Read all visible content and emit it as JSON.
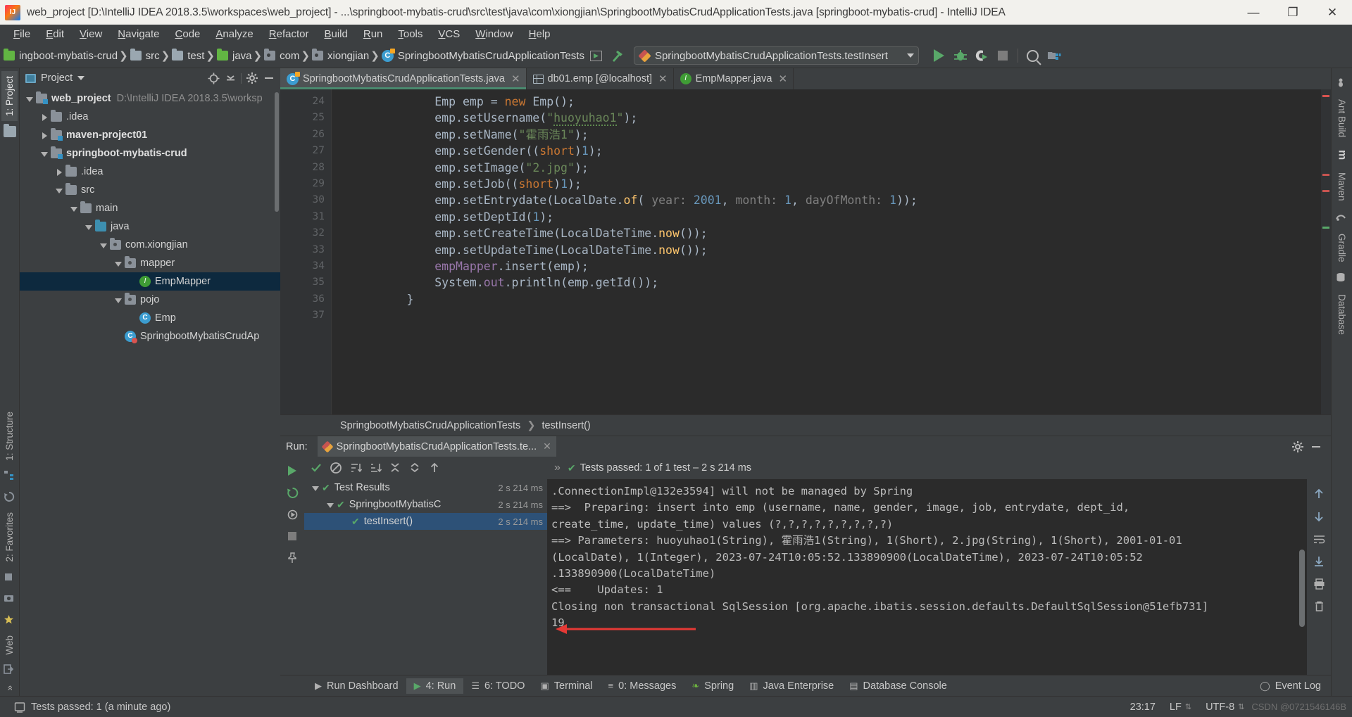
{
  "window": {
    "title": "web_project [D:\\IntelliJ IDEA 2018.3.5\\workspaces\\web_project] - ...\\springboot-mybatis-crud\\src\\test\\java\\com\\xiongjian\\SpringbootMybatisCrudApplicationTests.java [springboot-mybatis-crud] - IntelliJ IDEA",
    "minimize": "—",
    "maximize": "❐",
    "close": "✕"
  },
  "menu": [
    {
      "label": "File"
    },
    {
      "label": "Edit"
    },
    {
      "label": "View"
    },
    {
      "label": "Navigate"
    },
    {
      "label": "Code"
    },
    {
      "label": "Analyze"
    },
    {
      "label": "Refactor"
    },
    {
      "label": "Build"
    },
    {
      "label": "Run"
    },
    {
      "label": "Tools"
    },
    {
      "label": "VCS"
    },
    {
      "label": "Window"
    },
    {
      "label": "Help"
    }
  ],
  "navbar": {
    "crumbs": [
      {
        "label": "ingboot-mybatis-crud",
        "icon": "module-icon"
      },
      {
        "label": "src",
        "icon": "folder-icon"
      },
      {
        "label": "test",
        "icon": "folder-icon"
      },
      {
        "label": "java",
        "icon": "source-folder-icon"
      },
      {
        "label": "com",
        "icon": "package-icon"
      },
      {
        "label": "xiongjian",
        "icon": "package-icon"
      },
      {
        "label": "SpringbootMybatisCrudApplicationTests",
        "icon": "class-icon"
      }
    ],
    "run_config": "SpringbootMybatisCrudApplicationTests.testInsert",
    "icons": [
      "run-icon",
      "debug-icon",
      "run-with-coverage-icon",
      "stop-icon",
      "search-everywhere-icon",
      "project-structure-icon"
    ]
  },
  "sidebar_left": {
    "tabs": [
      {
        "label": "1: Project",
        "active": true
      }
    ],
    "icons": [
      "structure-icon",
      "favorites-icon",
      "web-icon"
    ]
  },
  "sidebar_right": {
    "tabs": [
      {
        "label": "Ant Build"
      },
      {
        "label": "m"
      },
      {
        "label": "Maven"
      },
      {
        "label": "Gradle"
      },
      {
        "label": "Database"
      }
    ]
  },
  "project_panel": {
    "title": "Project",
    "buttons": [
      "locate-icon",
      "collapse-all-icon",
      "settings-gear-icon",
      "hide-icon"
    ],
    "tree": [
      {
        "depth": 0,
        "label": "web_project",
        "sub": "D:\\IntelliJ IDEA 2018.3.5\\worksp",
        "twisty": "open",
        "icon": "module-icon",
        "bold": true,
        "selected": false
      },
      {
        "depth": 1,
        "label": ".idea",
        "sub": "",
        "twisty": "closed",
        "icon": "dir-icon",
        "bold": false,
        "selected": false
      },
      {
        "depth": 1,
        "label": "maven-project01",
        "sub": "",
        "twisty": "closed",
        "icon": "module-icon",
        "bold": true,
        "selected": false
      },
      {
        "depth": 1,
        "label": "springboot-mybatis-crud",
        "sub": "",
        "twisty": "open",
        "icon": "module-icon",
        "bold": true,
        "selected": false
      },
      {
        "depth": 2,
        "label": ".idea",
        "sub": "",
        "twisty": "closed",
        "icon": "dir-icon",
        "bold": false,
        "selected": false
      },
      {
        "depth": 2,
        "label": "src",
        "sub": "",
        "twisty": "open",
        "icon": "dir-icon",
        "bold": false,
        "selected": false
      },
      {
        "depth": 3,
        "label": "main",
        "sub": "",
        "twisty": "open",
        "icon": "dir-icon",
        "bold": false,
        "selected": false
      },
      {
        "depth": 4,
        "label": "java",
        "sub": "",
        "twisty": "open",
        "icon": "source-folder-icon",
        "bold": false,
        "selected": false
      },
      {
        "depth": 5,
        "label": "com.xiongjian",
        "sub": "",
        "twisty": "open",
        "icon": "package-icon",
        "bold": false,
        "selected": false
      },
      {
        "depth": 6,
        "label": "mapper",
        "sub": "",
        "twisty": "open",
        "icon": "package-icon",
        "bold": false,
        "selected": false
      },
      {
        "depth": 7,
        "label": "EmpMapper",
        "sub": "",
        "twisty": "none",
        "icon": "interface-icon",
        "bold": false,
        "selected": true
      },
      {
        "depth": 6,
        "label": "pojo",
        "sub": "",
        "twisty": "open",
        "icon": "package-icon",
        "bold": false,
        "selected": false
      },
      {
        "depth": 7,
        "label": "Emp",
        "sub": "",
        "twisty": "none",
        "icon": "class-icon",
        "bold": false,
        "selected": false
      },
      {
        "depth": 6,
        "label": "SpringbootMybatisCrudAp",
        "sub": "",
        "twisty": "none",
        "icon": "spring-class-icon",
        "bold": false,
        "selected": false
      }
    ]
  },
  "editor": {
    "tabs": [
      {
        "label": "SpringbootMybatisCrudApplicationTests.java",
        "icon": "java-class-icon",
        "active": true,
        "close": "✕"
      },
      {
        "label": "db01.emp [@localhost]",
        "icon": "database-table-icon",
        "active": false,
        "close": "✕"
      },
      {
        "label": "EmpMapper.java",
        "icon": "java-interface-icon",
        "active": false,
        "close": "✕"
      }
    ],
    "first_line_number": 24,
    "lines": [
      {
        "n": 24,
        "tokens": [
          {
            "t": "            ",
            "c": "punct"
          },
          {
            "t": "Emp",
            "c": "ident"
          },
          {
            "t": " emp ",
            "c": "ident"
          },
          {
            "t": "= ",
            "c": "punct"
          },
          {
            "t": "new ",
            "c": "kw"
          },
          {
            "t": "Emp",
            "c": "ident"
          },
          {
            "t": "();",
            "c": "punct"
          }
        ]
      },
      {
        "n": 25,
        "tokens": [
          {
            "t": "            ",
            "c": "punct"
          },
          {
            "t": "emp",
            "c": "ident"
          },
          {
            "t": ".",
            "c": "punct"
          },
          {
            "t": "setUsername",
            "c": "ident"
          },
          {
            "t": "(",
            "c": "punct"
          },
          {
            "t": "\"",
            "c": "str"
          },
          {
            "t": "huoyuhao1",
            "c": "str typo"
          },
          {
            "t": "\"",
            "c": "str"
          },
          {
            "t": ");",
            "c": "punct"
          }
        ]
      },
      {
        "n": 26,
        "tokens": [
          {
            "t": "            ",
            "c": "punct"
          },
          {
            "t": "emp",
            "c": "ident"
          },
          {
            "t": ".",
            "c": "punct"
          },
          {
            "t": "setName",
            "c": "ident"
          },
          {
            "t": "(",
            "c": "punct"
          },
          {
            "t": "\"霍雨浩1\"",
            "c": "str"
          },
          {
            "t": ");",
            "c": "punct"
          }
        ]
      },
      {
        "n": 27,
        "tokens": [
          {
            "t": "            ",
            "c": "punct"
          },
          {
            "t": "emp",
            "c": "ident"
          },
          {
            "t": ".",
            "c": "punct"
          },
          {
            "t": "setGender",
            "c": "ident"
          },
          {
            "t": "((",
            "c": "punct"
          },
          {
            "t": "short",
            "c": "kw"
          },
          {
            "t": ")",
            "c": "punct"
          },
          {
            "t": "1",
            "c": "num"
          },
          {
            "t": ");",
            "c": "punct"
          }
        ]
      },
      {
        "n": 28,
        "tokens": [
          {
            "t": "            ",
            "c": "punct"
          },
          {
            "t": "emp",
            "c": "ident"
          },
          {
            "t": ".",
            "c": "punct"
          },
          {
            "t": "setImage",
            "c": "ident"
          },
          {
            "t": "(",
            "c": "punct"
          },
          {
            "t": "\"2.jpg\"",
            "c": "str"
          },
          {
            "t": ");",
            "c": "punct"
          }
        ]
      },
      {
        "n": 29,
        "tokens": [
          {
            "t": "            ",
            "c": "punct"
          },
          {
            "t": "emp",
            "c": "ident"
          },
          {
            "t": ".",
            "c": "punct"
          },
          {
            "t": "setJob",
            "c": "ident"
          },
          {
            "t": "((",
            "c": "punct"
          },
          {
            "t": "short",
            "c": "kw"
          },
          {
            "t": ")",
            "c": "punct"
          },
          {
            "t": "1",
            "c": "num"
          },
          {
            "t": ");",
            "c": "punct"
          }
        ]
      },
      {
        "n": 30,
        "tokens": [
          {
            "t": "            ",
            "c": "punct"
          },
          {
            "t": "emp",
            "c": "ident"
          },
          {
            "t": ".",
            "c": "punct"
          },
          {
            "t": "setEntrydate",
            "c": "ident"
          },
          {
            "t": "(",
            "c": "punct"
          },
          {
            "t": "LocalDate",
            "c": "ident"
          },
          {
            "t": ".",
            "c": "punct"
          },
          {
            "t": "of",
            "c": "mth"
          },
          {
            "t": "( ",
            "c": "punct"
          },
          {
            "t": "year:",
            "c": "hint"
          },
          {
            "t": " ",
            "c": "punct"
          },
          {
            "t": "2001",
            "c": "num"
          },
          {
            "t": ", ",
            "c": "punct"
          },
          {
            "t": "month:",
            "c": "hint"
          },
          {
            "t": " ",
            "c": "punct"
          },
          {
            "t": "1",
            "c": "num"
          },
          {
            "t": ", ",
            "c": "punct"
          },
          {
            "t": "dayOfMonth:",
            "c": "hint"
          },
          {
            "t": " ",
            "c": "punct"
          },
          {
            "t": "1",
            "c": "num"
          },
          {
            "t": "));",
            "c": "punct"
          }
        ]
      },
      {
        "n": 31,
        "tokens": [
          {
            "t": "            ",
            "c": "punct"
          },
          {
            "t": "emp",
            "c": "ident"
          },
          {
            "t": ".",
            "c": "punct"
          },
          {
            "t": "setDeptId",
            "c": "ident"
          },
          {
            "t": "(",
            "c": "punct"
          },
          {
            "t": "1",
            "c": "num"
          },
          {
            "t": ");",
            "c": "punct"
          }
        ]
      },
      {
        "n": 32,
        "tokens": [
          {
            "t": "            ",
            "c": "punct"
          },
          {
            "t": "emp",
            "c": "ident"
          },
          {
            "t": ".",
            "c": "punct"
          },
          {
            "t": "setCreateTime",
            "c": "ident"
          },
          {
            "t": "(",
            "c": "punct"
          },
          {
            "t": "LocalDateTime",
            "c": "ident"
          },
          {
            "t": ".",
            "c": "punct"
          },
          {
            "t": "now",
            "c": "mth"
          },
          {
            "t": "());",
            "c": "punct"
          }
        ]
      },
      {
        "n": 33,
        "tokens": [
          {
            "t": "            ",
            "c": "punct"
          },
          {
            "t": "emp",
            "c": "ident"
          },
          {
            "t": ".",
            "c": "punct"
          },
          {
            "t": "setUpdateTime",
            "c": "ident"
          },
          {
            "t": "(",
            "c": "punct"
          },
          {
            "t": "LocalDateTime",
            "c": "ident"
          },
          {
            "t": ".",
            "c": "punct"
          },
          {
            "t": "now",
            "c": "mth"
          },
          {
            "t": "());",
            "c": "punct"
          }
        ]
      },
      {
        "n": 34,
        "tokens": [
          {
            "t": "            ",
            "c": "punct"
          },
          {
            "t": "empMapper",
            "c": "fld"
          },
          {
            "t": ".",
            "c": "punct"
          },
          {
            "t": "insert",
            "c": "ident"
          },
          {
            "t": "(emp);",
            "c": "punct"
          }
        ]
      },
      {
        "n": 35,
        "tokens": [
          {
            "t": "            ",
            "c": "punct"
          },
          {
            "t": "System",
            "c": "ident"
          },
          {
            "t": ".",
            "c": "punct"
          },
          {
            "t": "out",
            "c": "fld"
          },
          {
            "t": ".",
            "c": "punct"
          },
          {
            "t": "println",
            "c": "ident"
          },
          {
            "t": "(emp.",
            "c": "punct"
          },
          {
            "t": "getId",
            "c": "ident"
          },
          {
            "t": "());",
            "c": "punct"
          }
        ]
      },
      {
        "n": 36,
        "tokens": [
          {
            "t": "        }",
            "c": "punct"
          }
        ]
      },
      {
        "n": 37,
        "tokens": [
          {
            "t": "",
            "c": "punct"
          }
        ]
      }
    ],
    "breadcrumb": [
      "SpringbootMybatisCrudApplicationTests",
      "testInsert()"
    ]
  },
  "run_window": {
    "title": "Run:",
    "tab_label": "SpringbootMybatisCrudApplicationTests.te...",
    "tab_close": "✕",
    "header_buttons": [
      "settings-gear-icon",
      "hide-icon"
    ],
    "toolbar_icons": [
      "rerun-icon",
      "rerun-failed-icon",
      "toggle-auto-test-icon"
    ],
    "tests_toolbar_icons": [
      "show-passed-icon",
      "hide-ignored-icon",
      "sort-alpha-icon",
      "sort-duration-icon",
      "expand-all-icon",
      "collapse-all-icon",
      "prev-failed-icon",
      "next-failed-icon"
    ],
    "status_text": "Tests passed: 1 of 1 test – 2 s 214 ms",
    "status_chevrons": "»",
    "tests": [
      {
        "depth": 0,
        "label": "Test Results",
        "time": "2 s 214 ms",
        "twisty": "open",
        "selected": false
      },
      {
        "depth": 1,
        "label": "SpringbootMybatisC",
        "time": "2 s 214 ms",
        "twisty": "open",
        "selected": false
      },
      {
        "depth": 2,
        "label": "testInsert()",
        "time": "2 s 214 ms",
        "twisty": "none",
        "selected": true
      }
    ],
    "console_lines": [
      ".ConnectionImpl@132e3594] will not be managed by Spring",
      "==>  Preparing: insert into emp (username, name, gender, image, job, entrydate, dept_id,",
      "create_time, update_time) values (?,?,?,?,?,?,?,?,?)",
      "==> Parameters: huoyuhao1(String), 霍雨浩1(String), 1(Short), 2.jpg(String), 1(Short), 2001-01-01",
      "(LocalDate), 1(Integer), 2023-07-24T10:05:52.133890900(LocalDateTime), 2023-07-24T10:05:52",
      ".133890900(LocalDateTime)",
      "<==    Updates: 1",
      "Closing non transactional SqlSession [org.apache.ibatis.session.defaults.DefaultSqlSession@51efb731]",
      "19"
    ],
    "console_right_icons": [
      "scroll-up-icon",
      "scroll-down-icon",
      "soft-wrap-icon",
      "scroll-to-end-icon",
      "print-icon",
      "clear-all-icon"
    ]
  },
  "bottom_bar": {
    "items": [
      {
        "label": "Run Dashboard",
        "icon": "play-icon",
        "active": false
      },
      {
        "label": "4: Run",
        "icon": "play-icon",
        "active": true
      },
      {
        "label": "6: TODO",
        "icon": "todo-icon",
        "active": false
      },
      {
        "label": "Terminal",
        "icon": "terminal-icon",
        "active": false
      },
      {
        "label": "0: Messages",
        "icon": "messages-icon",
        "active": false
      },
      {
        "label": "Spring",
        "icon": "spring-leaf-icon",
        "active": false
      },
      {
        "label": "Java Enterprise",
        "icon": "java-ee-icon",
        "active": false
      },
      {
        "label": "Database Console",
        "icon": "database-console-icon",
        "active": false
      }
    ],
    "right": {
      "label": "Event Log",
      "icon": "event-log-icon"
    }
  },
  "status_bar": {
    "message": "Tests passed: 1 (a minute ago)",
    "message_icon": "info-icon",
    "time": "23:17",
    "line_separator": "LF",
    "encoding": "UTF-8",
    "watermark": "CSDN @0721546146B"
  }
}
